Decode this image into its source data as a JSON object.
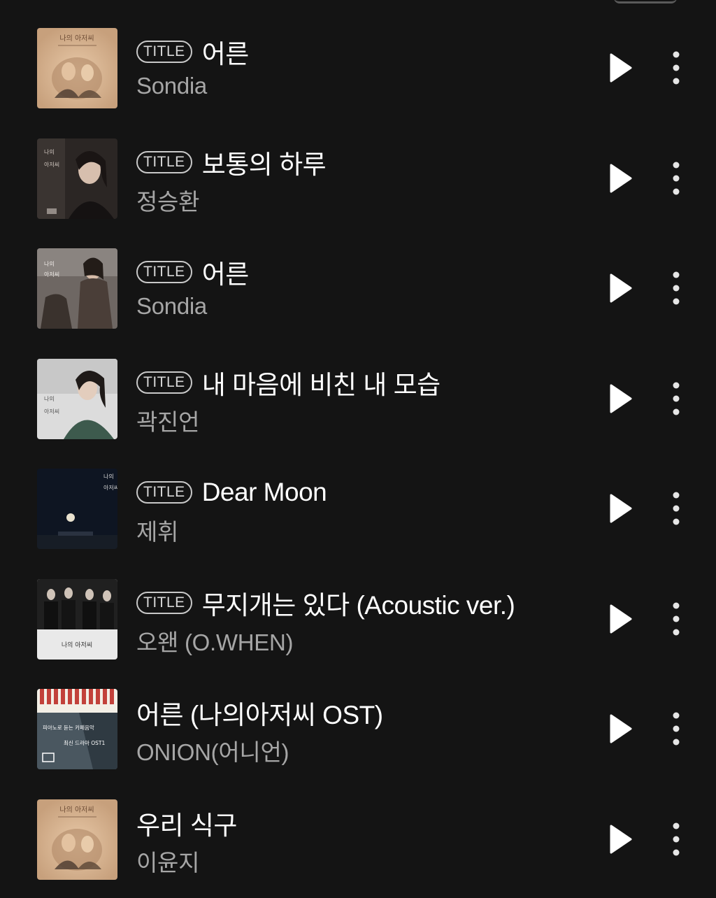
{
  "header": {
    "partial_label": ""
  },
  "badge_label": "TITLE",
  "songs": [
    {
      "title": "어른",
      "artist": "Sondia",
      "has_badge": true,
      "art": "warm"
    },
    {
      "title": "보통의 하루",
      "artist": "정승환",
      "has_badge": true,
      "art": "dark1"
    },
    {
      "title": "어른",
      "artist": "Sondia",
      "has_badge": true,
      "art": "dark2"
    },
    {
      "title": "내 마음에 비친 내 모습",
      "artist": "곽진언",
      "has_badge": true,
      "art": "green"
    },
    {
      "title": "Dear Moon",
      "artist": "제휘",
      "has_badge": true,
      "art": "night"
    },
    {
      "title": "무지개는 있다 (Acoustic ver.)",
      "artist": "오왠 (O.WHEN)",
      "has_badge": true,
      "art": "group"
    },
    {
      "title": "어른 (나의아저씨 OST)",
      "artist": "ONION(어니언)",
      "has_badge": false,
      "art": "piano",
      "art_text": [
        "피아노로 듣는 카페음악",
        "최신 드라마 OST1"
      ]
    },
    {
      "title": "우리 식구",
      "artist": "이윤지",
      "has_badge": false,
      "art": "warm"
    }
  ],
  "icons": {
    "play": "play-icon",
    "more": "more-vertical-icon"
  },
  "colors": {
    "background": "#141414",
    "artist_text": "#a6a6a6",
    "badge_border": "#c9c9c9"
  }
}
